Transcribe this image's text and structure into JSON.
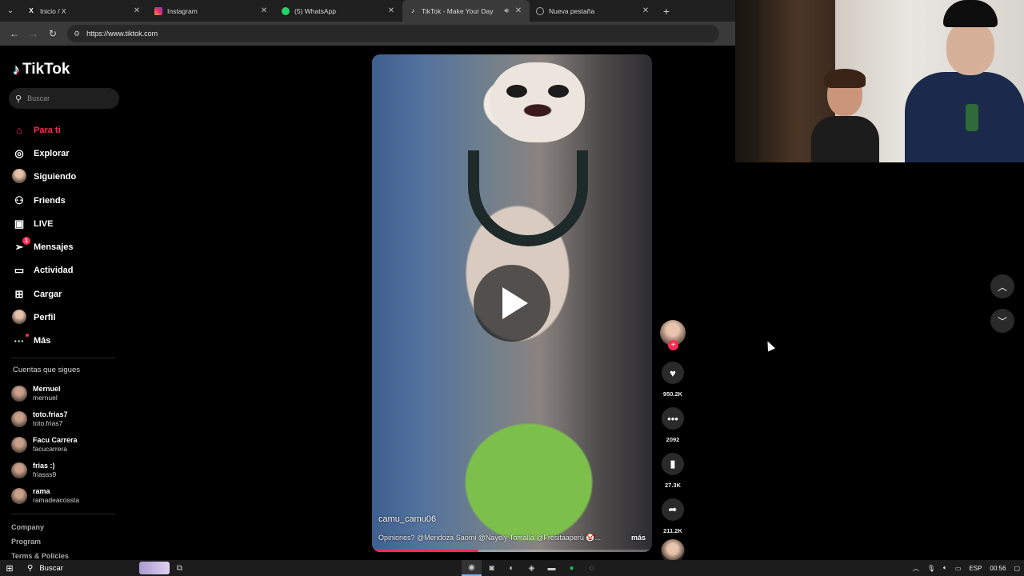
{
  "browser": {
    "tabs": [
      {
        "title": "Inicio / X",
        "icon": "x-logo-icon",
        "active": false
      },
      {
        "title": "Instagram",
        "icon": "instagram-icon",
        "active": false
      },
      {
        "title": "(5) WhatsApp",
        "icon": "whatsapp-icon",
        "active": false
      },
      {
        "title": "TikTok - Make Your Day",
        "icon": "tiktok-icon",
        "active": true
      },
      {
        "title": "Nueva pestaña",
        "icon": "chrome-icon",
        "active": false
      }
    ],
    "url": "https://www.tiktok.com"
  },
  "sidebar": {
    "logo_text": "TikTok",
    "search_placeholder": "Buscar",
    "nav": [
      {
        "label": "Para ti",
        "icon": "home-icon",
        "active": true
      },
      {
        "label": "Explorar",
        "icon": "compass-icon"
      },
      {
        "label": "Siguiendo",
        "icon": "avatar-icon"
      },
      {
        "label": "Friends",
        "icon": "friends-icon"
      },
      {
        "label": "LIVE",
        "icon": "live-icon"
      },
      {
        "label": "Mensajes",
        "icon": "send-icon",
        "badge": "1"
      },
      {
        "label": "Actividad",
        "icon": "activity-icon"
      },
      {
        "label": "Cargar",
        "icon": "upload-icon"
      },
      {
        "label": "Perfil",
        "icon": "profile-icon"
      },
      {
        "label": "Más",
        "icon": "more-icon"
      }
    ],
    "following_title": "Cuentas que sigues",
    "following": [
      {
        "name": "Mernuel",
        "handle": "mernuel"
      },
      {
        "name": "toto.frias7",
        "handle": "toto.frias7"
      },
      {
        "name": "Facu Carrera",
        "handle": "facucarrera"
      },
      {
        "name": "frias :)",
        "handle": "friasss9"
      },
      {
        "name": "rama",
        "handle": "ramadeacossta"
      }
    ],
    "footer": [
      "Company",
      "Program",
      "Terms & Policies"
    ]
  },
  "video": {
    "username": "camu_camu06",
    "caption": "Opiniones? @Mendoza Saomi @Nayely Tomalla @Fresitaaperú 🤡...",
    "more_label": "más",
    "progress": 0.38
  },
  "actions": {
    "likes": "950.2K",
    "comments": "2092",
    "saves": "27.3K",
    "shares": "211.2K"
  },
  "taskbar": {
    "search_label": "Buscar",
    "language": "ESP",
    "time": "00:56"
  },
  "colors": {
    "accent": "#fe2c55",
    "background": "#000000"
  }
}
